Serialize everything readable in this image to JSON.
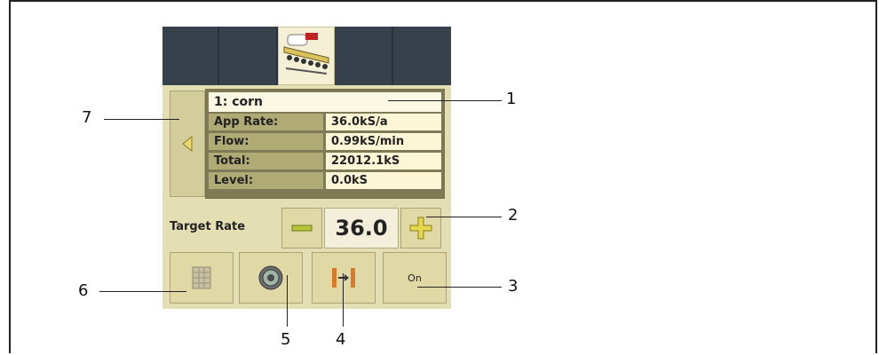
{
  "product": {
    "title": "1: corn",
    "rows": [
      {
        "label": "App Rate:",
        "value": "36.0kS/a"
      },
      {
        "label": "Flow:",
        "value": "0.99kS/min"
      },
      {
        "label": "Total:",
        "value": "22012.1kS"
      },
      {
        "label": "Level:",
        "value": "0.0kS"
      }
    ]
  },
  "target_rate": {
    "label": "Target Rate",
    "value": "36.0"
  },
  "bottom_buttons": {
    "on_label": "On"
  },
  "callouts": [
    "1",
    "2",
    "3",
    "4",
    "5",
    "6",
    "7"
  ],
  "colors": {
    "panel": "#e4dfb3",
    "tab_dark": "#36414c",
    "button_green": "#b5c63a",
    "plus_yellow": "#e2d84a"
  }
}
